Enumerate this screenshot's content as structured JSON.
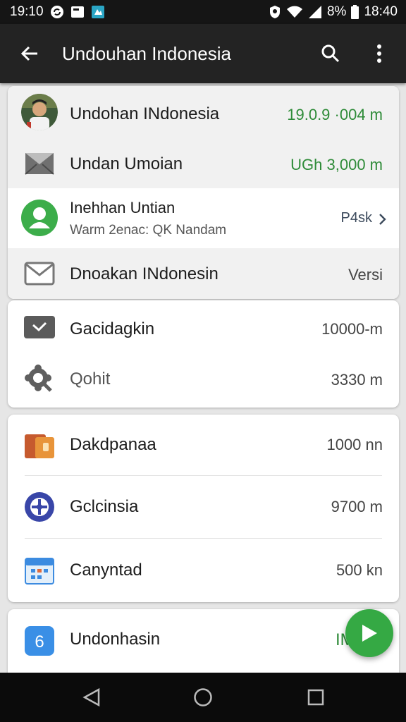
{
  "status_bar": {
    "time_left": "19:10",
    "battery_percent": "8%",
    "time_right": "18:40",
    "icons": [
      "sync-icon",
      "image-icon",
      "app-icon",
      "shield-icon",
      "wifi-icon",
      "signal-icon",
      "battery-icon"
    ]
  },
  "app_bar": {
    "title": "Undouhan Indonesia",
    "back_icon": "arrow-left-icon",
    "search_icon": "search-icon",
    "more_icon": "more-vert-icon"
  },
  "card1": {
    "rows": [
      {
        "label": "Undohan INdonesia",
        "value": "19.0.9 ·004 m",
        "icon": "avatar-photo"
      },
      {
        "label": "Undan Umoian",
        "value": "UGh 3,000 m",
        "icon": "mail-open-icon"
      },
      {
        "label": "Inehhan Untian",
        "sublabel": "Warm 2enac: QK Nandam",
        "value": "P4sk",
        "icon": "person-icon"
      },
      {
        "label": "Dnoakan INdonesin",
        "value": "Versi",
        "icon": "mail-icon"
      }
    ]
  },
  "card2": {
    "rows": [
      {
        "label": "Gacidagkin",
        "value": "10000-m",
        "icon": "checkbox-icon"
      },
      {
        "label": "Qohit",
        "value": "3330  m",
        "icon": "gear-search-icon"
      }
    ]
  },
  "card3": {
    "rows": [
      {
        "label": "Dakdpanaa",
        "value": "1000  nn",
        "icon": "wallet-icon"
      },
      {
        "label": "Gclcinsia",
        "value": "9700 m",
        "icon": "compass-icon"
      },
      {
        "label": "Canyntad",
        "value": "500  kn",
        "icon": "calendar-icon"
      }
    ]
  },
  "card4": {
    "rows": [
      {
        "label": "Undonhasin",
        "value": "IMo",
        "icon": "number-six-icon",
        "icon_text": "6"
      }
    ]
  },
  "fab": {
    "icon": "play-icon"
  },
  "nav_bar": {
    "icons": [
      "nav-back-icon",
      "nav-home-icon",
      "nav-recents-icon"
    ]
  },
  "colors": {
    "green": "#2e8b38",
    "fab": "#35a944",
    "app_bar": "#232323"
  }
}
